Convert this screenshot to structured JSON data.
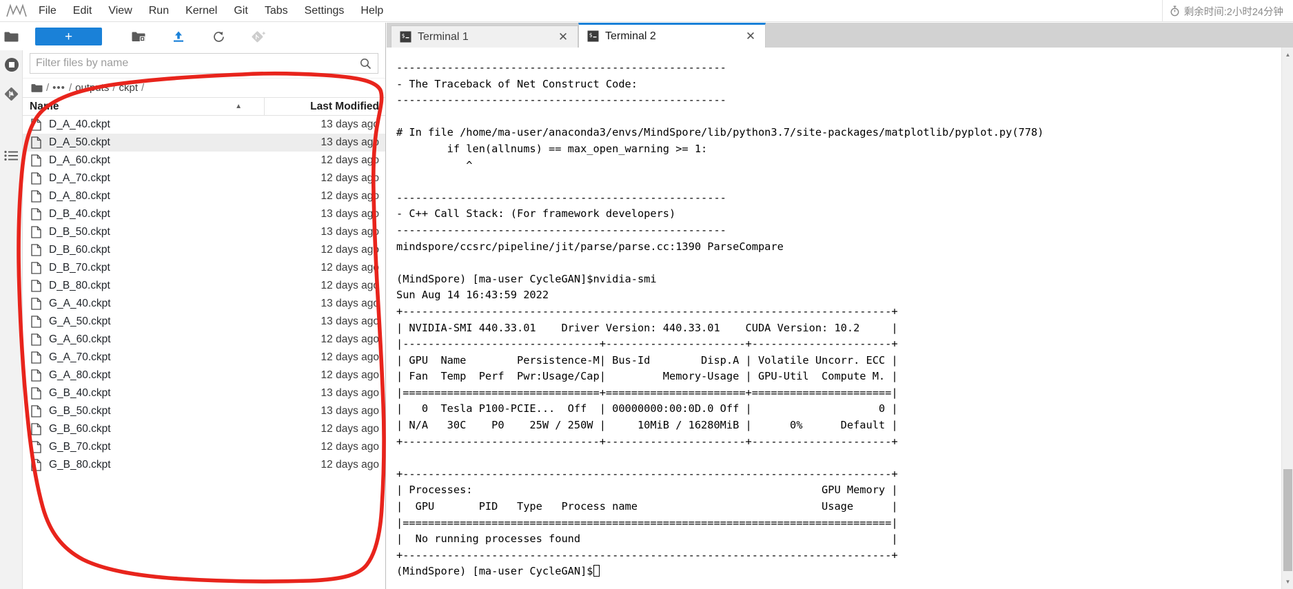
{
  "menubar": {
    "logo_icon": "jupyter-logo-icon",
    "items": [
      {
        "label": "File"
      },
      {
        "label": "Edit"
      },
      {
        "label": "View"
      },
      {
        "label": "Run"
      },
      {
        "label": "Kernel"
      },
      {
        "label": "Git"
      },
      {
        "label": "Tabs"
      },
      {
        "label": "Settings"
      },
      {
        "label": "Help"
      }
    ],
    "timer": {
      "icon": "stopwatch-icon",
      "text": "剩余时间:2小时24分钟"
    }
  },
  "activitybar": {
    "items": [
      {
        "name": "file-browser",
        "icon": "folder-icon"
      },
      {
        "name": "running-terminals",
        "icon": "stop-circle-icon"
      },
      {
        "name": "git-panel",
        "icon": "git-diamond-icon"
      },
      {
        "name": "commands-palette",
        "icon": "list-icon"
      }
    ]
  },
  "filebrowser": {
    "toolbar": {
      "new_launcher_label": "+",
      "new_folder_icon": "new-folder-icon",
      "upload_icon": "upload-arrow-icon",
      "refresh_icon": "refresh-icon",
      "git_clone_icon": "git-clone-icon"
    },
    "filter": {
      "placeholder": "Filter files by name",
      "value": "",
      "search_icon": "search-icon"
    },
    "breadcrumb": {
      "home_icon": "folder-icon",
      "parts": [
        "/",
        "…",
        "/",
        "outputs",
        "/",
        "ckpt",
        "/"
      ],
      "ellipsis": "•••",
      "segments": [
        "outputs",
        "ckpt"
      ]
    },
    "columns": {
      "name": "Name",
      "last_modified": "Last Modified",
      "sort_indicator": "▲"
    },
    "files": [
      {
        "name": "D_A_40.ckpt",
        "modified": "13 days ago",
        "selected": false
      },
      {
        "name": "D_A_50.ckpt",
        "modified": "13 days ago",
        "selected": true
      },
      {
        "name": "D_A_60.ckpt",
        "modified": "12 days ago",
        "selected": false
      },
      {
        "name": "D_A_70.ckpt",
        "modified": "12 days ago",
        "selected": false
      },
      {
        "name": "D_A_80.ckpt",
        "modified": "12 days ago",
        "selected": false
      },
      {
        "name": "D_B_40.ckpt",
        "modified": "13 days ago",
        "selected": false
      },
      {
        "name": "D_B_50.ckpt",
        "modified": "13 days ago",
        "selected": false
      },
      {
        "name": "D_B_60.ckpt",
        "modified": "12 days ago",
        "selected": false
      },
      {
        "name": "D_B_70.ckpt",
        "modified": "12 days ago",
        "selected": false
      },
      {
        "name": "D_B_80.ckpt",
        "modified": "12 days ago",
        "selected": false
      },
      {
        "name": "G_A_40.ckpt",
        "modified": "13 days ago",
        "selected": false
      },
      {
        "name": "G_A_50.ckpt",
        "modified": "13 days ago",
        "selected": false
      },
      {
        "name": "G_A_60.ckpt",
        "modified": "12 days ago",
        "selected": false
      },
      {
        "name": "G_A_70.ckpt",
        "modified": "12 days ago",
        "selected": false
      },
      {
        "name": "G_A_80.ckpt",
        "modified": "12 days ago",
        "selected": false
      },
      {
        "name": "G_B_40.ckpt",
        "modified": "13 days ago",
        "selected": false
      },
      {
        "name": "G_B_50.ckpt",
        "modified": "13 days ago",
        "selected": false
      },
      {
        "name": "G_B_60.ckpt",
        "modified": "12 days ago",
        "selected": false
      },
      {
        "name": "G_B_70.ckpt",
        "modified": "12 days ago",
        "selected": false
      },
      {
        "name": "G_B_80.ckpt",
        "modified": "12 days ago",
        "selected": false
      }
    ]
  },
  "main": {
    "tabs": [
      {
        "label": "Terminal 1",
        "active": false,
        "icon": "terminal-icon",
        "close_icon": "close-icon"
      },
      {
        "label": "Terminal 2",
        "active": true,
        "icon": "terminal-icon",
        "close_icon": "close-icon"
      }
    ],
    "terminal": {
      "lines": [
        "----------------------------------------------------",
        "- The Traceback of Net Construct Code:",
        "----------------------------------------------------",
        "",
        "# In file /home/ma-user/anaconda3/envs/MindSpore/lib/python3.7/site-packages/matplotlib/pyplot.py(778)",
        "        if len(allnums) == max_open_warning >= 1:",
        "           ^",
        "",
        "----------------------------------------------------",
        "- C++ Call Stack: (For framework developers)",
        "----------------------------------------------------",
        "mindspore/ccsrc/pipeline/jit/parse/parse.cc:1390 ParseCompare",
        "",
        "(MindSpore) [ma-user CycleGAN]$nvidia-smi",
        "Sun Aug 14 16:43:59 2022",
        "+-----------------------------------------------------------------------------+",
        "| NVIDIA-SMI 440.33.01    Driver Version: 440.33.01    CUDA Version: 10.2     |",
        "|-------------------------------+----------------------+----------------------+",
        "| GPU  Name        Persistence-M| Bus-Id        Disp.A | Volatile Uncorr. ECC |",
        "| Fan  Temp  Perf  Pwr:Usage/Cap|         Memory-Usage | GPU-Util  Compute M. |",
        "|===============================+======================+======================|",
        "|   0  Tesla P100-PCIE...  Off  | 00000000:00:0D.0 Off |                    0 |",
        "| N/A   30C    P0    25W / 250W |     10MiB / 16280MiB |      0%      Default |",
        "+-------------------------------+----------------------+----------------------+",
        "",
        "+-----------------------------------------------------------------------------+",
        "| Processes:                                                       GPU Memory |",
        "|  GPU       PID   Type   Process name                             Usage      |",
        "|=============================================================================|",
        "|  No running processes found                                                 |",
        "+-----------------------------------------------------------------------------+"
      ],
      "prompt": "(MindSpore) [ma-user CycleGAN]$"
    }
  },
  "annotation": {
    "color": "#e8241c",
    "shape": "hand-drawn-circle-around-file-list"
  },
  "scrollbar": {
    "up_arrow": "▲",
    "down_arrow": "▼"
  }
}
